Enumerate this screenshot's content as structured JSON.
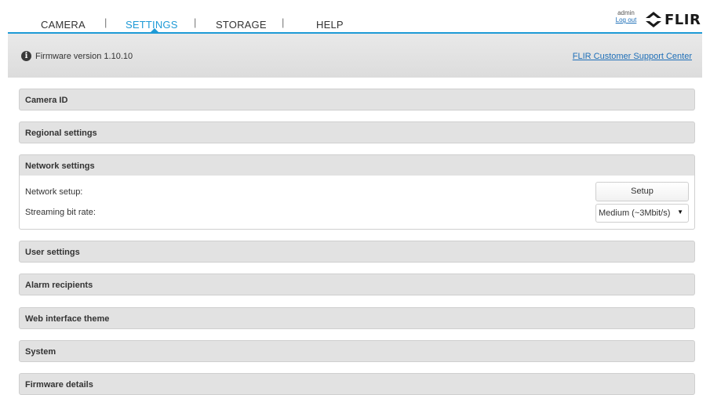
{
  "nav": {
    "items": [
      "CAMERA",
      "SETTINGS",
      "STORAGE",
      "HELP"
    ],
    "active": "SETTINGS",
    "separator": "|"
  },
  "user": {
    "name": "admin",
    "logout": "Log out"
  },
  "logo": {
    "text": "FLIR",
    "icon": "flir-logo-icon"
  },
  "firmware_bar": {
    "info_glyph": "i",
    "version_text": "Firmware version 1.10.10",
    "support_link": "FLIR Customer Support Center"
  },
  "panels": [
    {
      "title": "Camera ID"
    },
    {
      "title": "Regional settings"
    },
    {
      "title": "Network settings"
    },
    {
      "title": "User settings"
    },
    {
      "title": "Alarm recipients"
    },
    {
      "title": "Web interface theme"
    },
    {
      "title": "System"
    },
    {
      "title": "Firmware details"
    }
  ],
  "network": {
    "setup_label": "Network setup:",
    "setup_button": "Setup",
    "bitrate_label": "Streaming bit rate:",
    "bitrate_value": "Medium (~3Mbit/s)",
    "dropdown_arrow": "▼"
  },
  "colors": {
    "accent": "#1e9ad6",
    "link": "#1e6fb8"
  }
}
